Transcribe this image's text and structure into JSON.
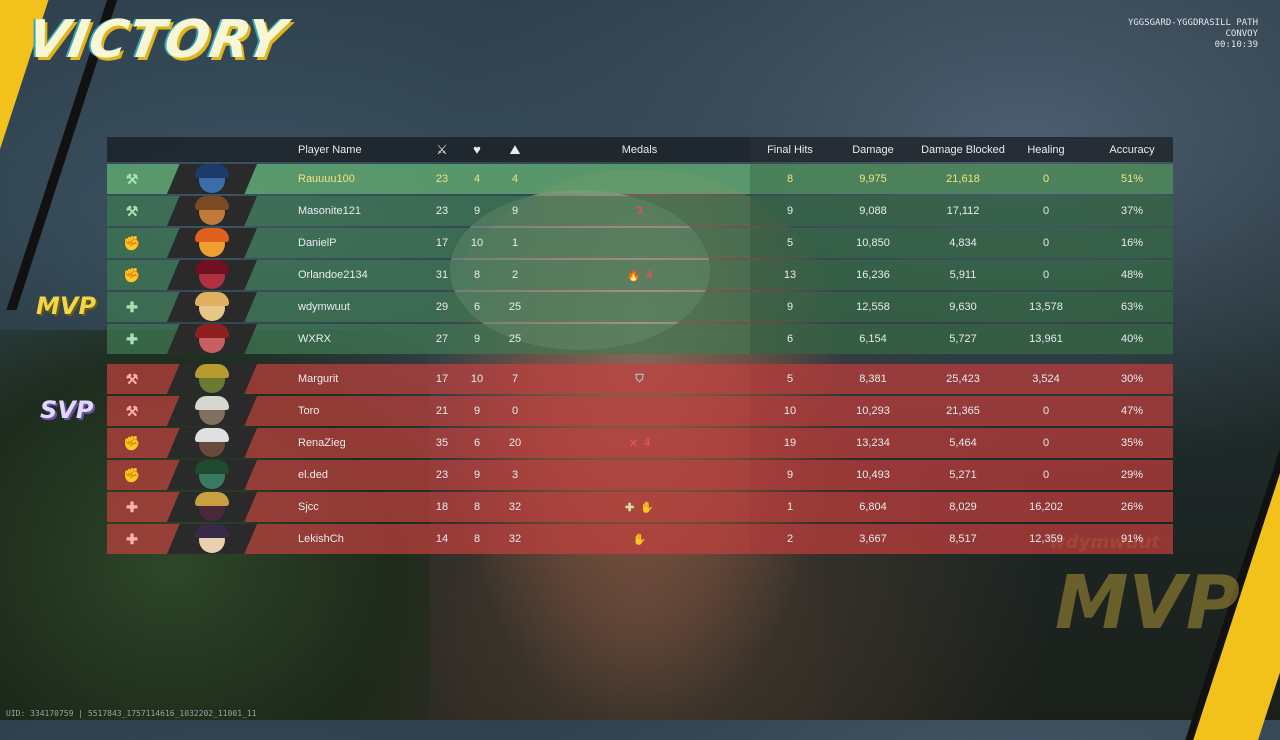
{
  "title": "VICTORY",
  "map": {
    "line1": "YGGSGARD-YGGDRASILL PATH",
    "line2": "CONVOY",
    "time": "00:10:39"
  },
  "tags": {
    "mvp": "MVP",
    "svp": "SVP"
  },
  "bg_mvp": {
    "name": "wdymwuut",
    "label": "MVP"
  },
  "uid": "UID: 334170759 | 5517843_1757114616_1032202_11001_11",
  "header": {
    "player_name": "Player Name",
    "kills_icon": "crossed-swords-icon",
    "deaths_icon": "broken-heart-icon",
    "assists_icon": "assist-icon",
    "medals": "Medals",
    "final_hits": "Final Hits",
    "damage": "Damage",
    "damage_blocked": "Damage Blocked",
    "healing": "Healing",
    "accuracy": "Accuracy"
  },
  "allies": [
    {
      "role": "vanguard",
      "role_glyph": "⚒",
      "name": "Rauuuu100",
      "k": "23",
      "d": "4",
      "a": "4",
      "medals": [],
      "final_hits": "8",
      "damage": "9,975",
      "blocked": "21,618",
      "healing": "0",
      "accuracy": "51%",
      "face": "#3b6ea8",
      "hair": "#1c3a6a"
    },
    {
      "role": "vanguard",
      "role_glyph": "⚒",
      "name": "Masonite121",
      "k": "23",
      "d": "9",
      "a": "9",
      "medals": [
        {
          "icon": "fire-medal-icon",
          "glyph": "3",
          "kind": "fire"
        }
      ],
      "final_hits": "9",
      "damage": "9,088",
      "blocked": "17,112",
      "healing": "0",
      "accuracy": "37%",
      "face": "#c07a3a",
      "hair": "#7a4a22"
    },
    {
      "role": "duelist",
      "role_glyph": "✊",
      "name": "DanielP",
      "k": "17",
      "d": "10",
      "a": "1",
      "medals": [],
      "final_hits": "5",
      "damage": "10,850",
      "blocked": "4,834",
      "healing": "0",
      "accuracy": "16%",
      "face": "#f0a030",
      "hair": "#e06020"
    },
    {
      "role": "duelist",
      "role_glyph": "✊",
      "name": "Orlandoe2134",
      "k": "31",
      "d": "8",
      "a": "2",
      "medals": [
        {
          "icon": "flame-medal-icon",
          "glyph": "🔥",
          "kind": "fire"
        },
        {
          "icon": "fire-medal-icon",
          "glyph": "4",
          "kind": "fire"
        }
      ],
      "final_hits": "13",
      "damage": "16,236",
      "blocked": "5,911",
      "healing": "0",
      "accuracy": "48%",
      "face": "#b03040",
      "hair": "#701020"
    },
    {
      "role": "strategist",
      "role_glyph": "✚",
      "name": "wdymwuut",
      "k": "29",
      "d": "6",
      "a": "25",
      "medals": [],
      "final_hits": "9",
      "damage": "12,558",
      "blocked": "9,630",
      "healing": "13,578",
      "accuracy": "63%",
      "face": "#e8c888",
      "hair": "#e0b060"
    },
    {
      "role": "strategist",
      "role_glyph": "✚",
      "name": "WXRX",
      "k": "27",
      "d": "9",
      "a": "25",
      "medals": [],
      "final_hits": "6",
      "damage": "6,154",
      "blocked": "5,727",
      "healing": "13,961",
      "accuracy": "40%",
      "face": "#c86060",
      "hair": "#902020"
    }
  ],
  "enemies": [
    {
      "role": "vanguard",
      "role_glyph": "⚒",
      "name": "Margurit",
      "k": "17",
      "d": "10",
      "a": "7",
      "medals": [
        {
          "icon": "shield-medal-icon",
          "glyph": "⛉",
          "kind": "shield"
        }
      ],
      "final_hits": "5",
      "damage": "8,381",
      "blocked": "25,423",
      "healing": "3,524",
      "accuracy": "30%",
      "face": "#6a7a30",
      "hair": "#b89a30"
    },
    {
      "role": "vanguard",
      "role_glyph": "⚒",
      "name": "Toro",
      "k": "21",
      "d": "9",
      "a": "0",
      "medals": [],
      "final_hits": "10",
      "damage": "10,293",
      "blocked": "21,365",
      "healing": "0",
      "accuracy": "47%",
      "face": "#807060",
      "hair": "#d8d8d0"
    },
    {
      "role": "duelist",
      "role_glyph": "✊",
      "name": "RenaZieg",
      "k": "35",
      "d": "6",
      "a": "20",
      "medals": [
        {
          "icon": "crossed-swords-medal-icon",
          "glyph": "✕",
          "kind": "fire"
        },
        {
          "icon": "fire-medal-icon",
          "glyph": "4",
          "kind": "fire"
        }
      ],
      "final_hits": "19",
      "damage": "13,234",
      "blocked": "5,464",
      "healing": "0",
      "accuracy": "35%",
      "face": "#6a4a3a",
      "hair": "#e0e0e0"
    },
    {
      "role": "duelist",
      "role_glyph": "✊",
      "name": "el.ded",
      "k": "23",
      "d": "9",
      "a": "3",
      "medals": [],
      "final_hits": "9",
      "damage": "10,493",
      "blocked": "5,271",
      "healing": "0",
      "accuracy": "29%",
      "face": "#3a7a60",
      "hair": "#204a30"
    },
    {
      "role": "strategist",
      "role_glyph": "✚",
      "name": "Sjcc",
      "k": "18",
      "d": "8",
      "a": "32",
      "medals": [
        {
          "icon": "heal-medal-icon",
          "glyph": "✚",
          "kind": "heal"
        },
        {
          "icon": "assist-medal-icon",
          "glyph": "✋",
          "kind": "heal"
        }
      ],
      "final_hits": "1",
      "damage": "6,804",
      "blocked": "8,029",
      "healing": "16,202",
      "accuracy": "26%",
      "face": "#4a2a3a",
      "hair": "#c8a040"
    },
    {
      "role": "strategist",
      "role_glyph": "✚",
      "name": "LekishCh",
      "k": "14",
      "d": "8",
      "a": "32",
      "medals": [
        {
          "icon": "assist-medal-icon",
          "glyph": "✋",
          "kind": "heal"
        }
      ],
      "final_hits": "2",
      "damage": "3,667",
      "blocked": "8,517",
      "healing": "12,359",
      "accuracy": "91%",
      "face": "#e8d0b0",
      "hair": "#3a2a4a"
    }
  ]
}
